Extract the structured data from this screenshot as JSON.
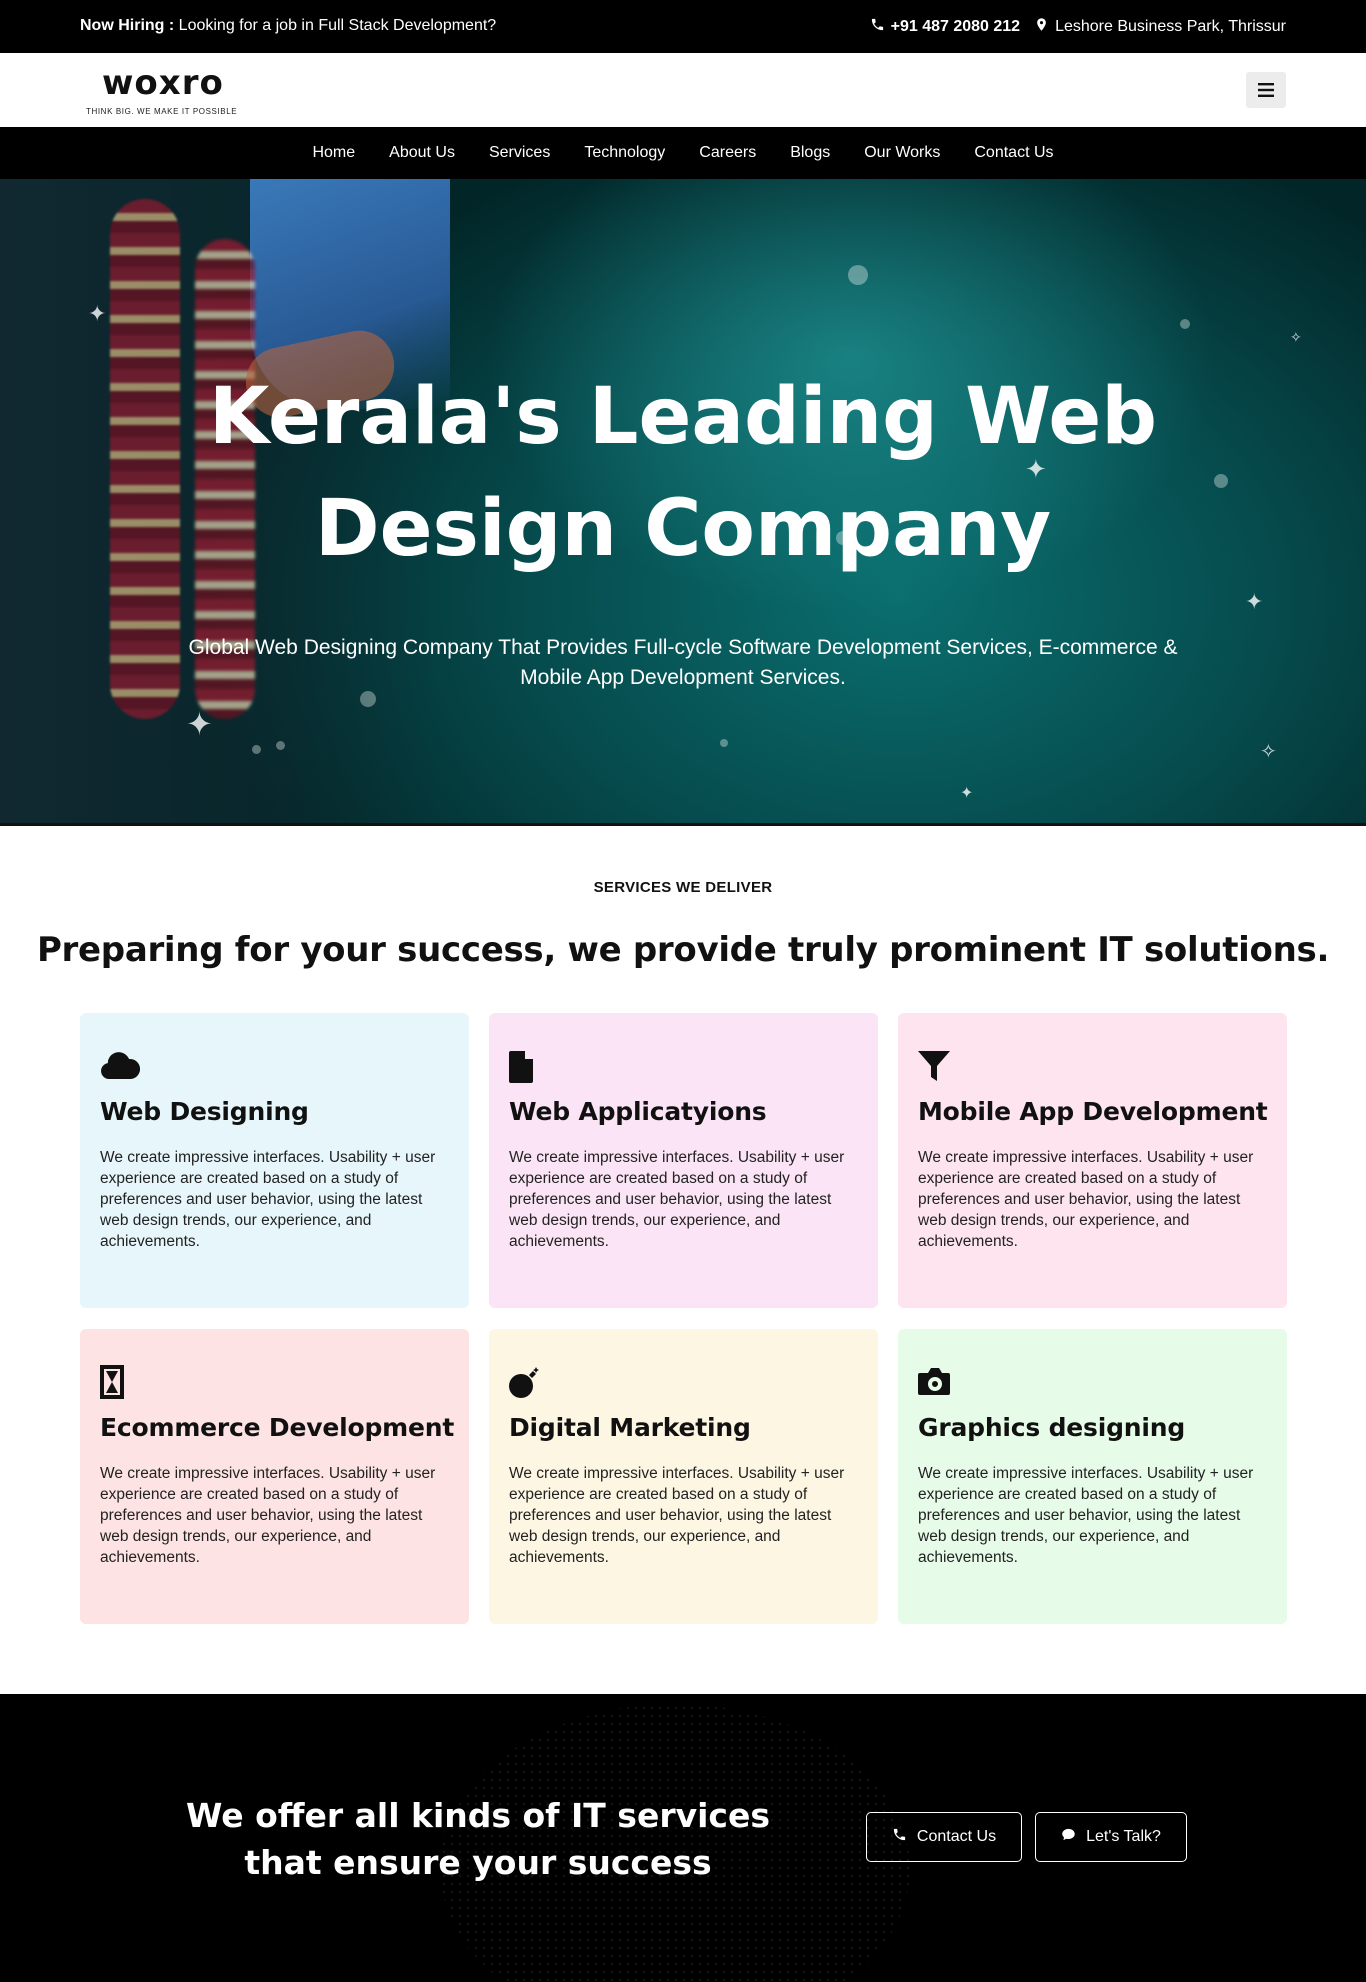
{
  "topbar": {
    "hiring_label": "Now Hiring :",
    "hiring_text": "Looking for a job in Full Stack Development?",
    "phone": "+91 487 2080 212",
    "address": "Leshore Business Park, Thrissur"
  },
  "header": {
    "logo_text": "woxro",
    "logo_tagline": "THINK BIG. WE MAKE IT POSSIBLE"
  },
  "nav": {
    "items": [
      "Home",
      "About Us",
      "Services",
      "Technology",
      "Careers",
      "Blogs",
      "Our Works",
      "Contact Us"
    ]
  },
  "hero": {
    "title_line1": "Kerala's Leading Web",
    "title_line2": "Design Company",
    "subtitle": "Global Web Designing Company That Provides Full-cycle Software Development Services, E-commerce & Mobile App Development Services."
  },
  "services": {
    "eyebrow": "SERVICES WE DELIVER",
    "title": "Preparing for your success, we provide truly prominent IT solutions.",
    "cards": [
      {
        "title": "Web Designing",
        "icon": "cloud-icon",
        "bg": "#e6f6fb",
        "text": "We create impressive interfaces. Usability + user experience are created based on a study of preferences and user behavior, using the latest web design trends, our experience, and achievements."
      },
      {
        "title": "Web Applicatyions",
        "icon": "file-icon",
        "bg": "#fbe4f5",
        "text": "We create impressive interfaces. Usability + user experience are created based on a study of preferences and user behavior, using the latest web design trends, our experience, and achievements."
      },
      {
        "title": "Mobile App Development",
        "icon": "filter-icon",
        "bg": "#fde4ee",
        "text": "We create impressive interfaces. Usability + user experience are created based on a study of preferences and user behavior, using the latest web design trends, our experience, and achievements."
      },
      {
        "title": "Ecommerce Development",
        "icon": "hourglass-icon",
        "bg": "#fde3e3",
        "text": "We create impressive interfaces. Usability + user experience are created based on a study of preferences and user behavior, using the latest web design trends, our experience, and achievements."
      },
      {
        "title": "Digital Marketing",
        "icon": "bomb-icon",
        "bg": "#fdf6e3",
        "text": "We create impressive interfaces. Usability + user experience are created based on a study of preferences and user behavior, using the latest web design trends, our experience, and achievements."
      },
      {
        "title": "Graphics designing",
        "icon": "camera-icon",
        "bg": "#e6fbe8",
        "text": "We create impressive interfaces. Usability + user experience are created based on a study of preferences and user behavior, using the latest web design trends, our experience, and achievements."
      }
    ]
  },
  "cta": {
    "title": "We offer all kinds of IT services that ensure your success",
    "contact_label": "Contact Us",
    "talk_label": "Let's Talk?"
  }
}
